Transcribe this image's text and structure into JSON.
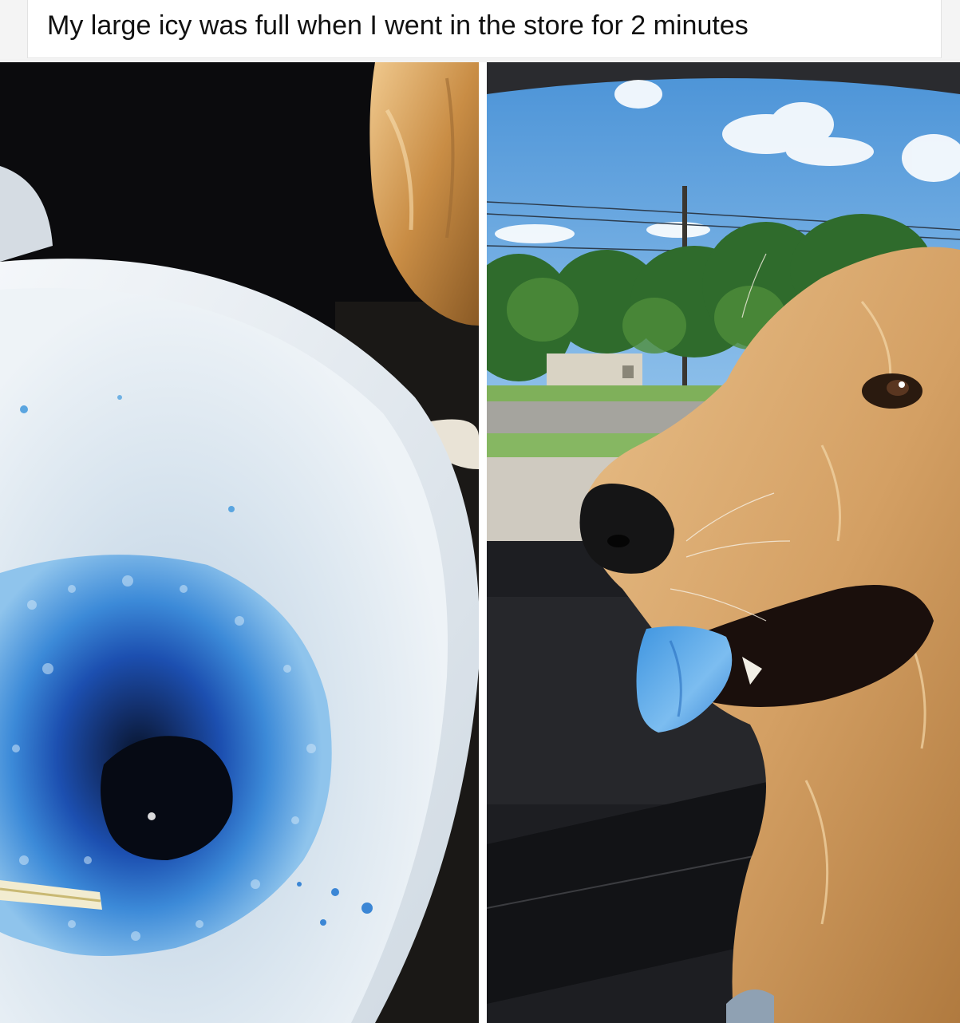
{
  "post": {
    "caption": "My large icy was full when I went in the store for 2 minutes"
  },
  "photos": [
    {
      "subject": "empty-icy-cup"
    },
    {
      "subject": "dog-with-blue-tongue"
    }
  ],
  "colors": {
    "icy_blue": "#3a86d6",
    "dog_fur": "#d7a86a",
    "sky": "#8ec3ee",
    "cup": "#dfe9f1"
  }
}
